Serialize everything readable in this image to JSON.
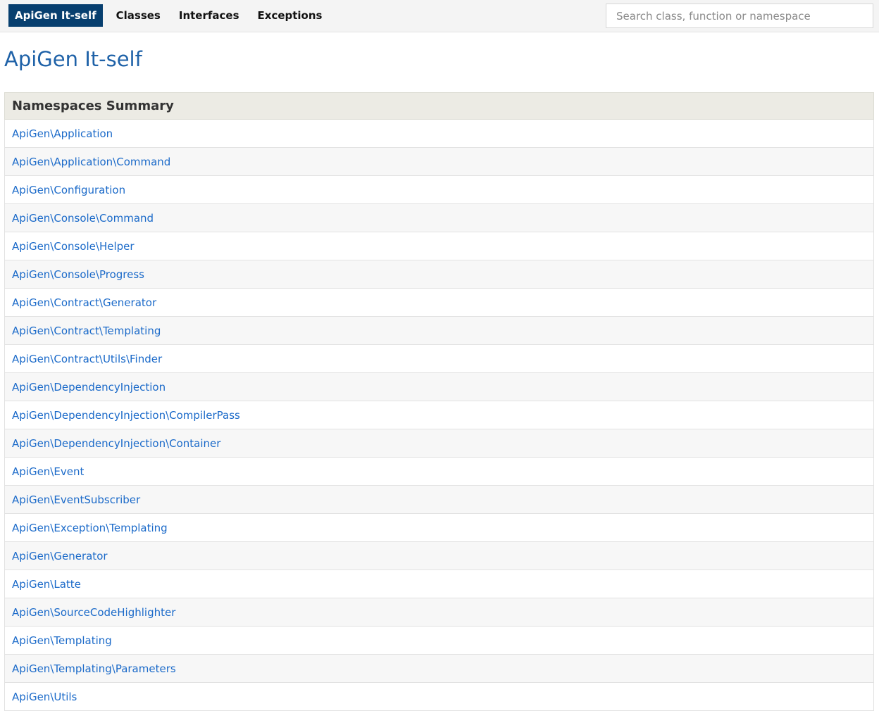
{
  "nav": {
    "brand": "ApiGen It-self",
    "items": [
      "Classes",
      "Interfaces",
      "Exceptions"
    ]
  },
  "search": {
    "placeholder": "Search class, function or namespace",
    "value": ""
  },
  "page_title": "ApiGen It-self",
  "summary": {
    "heading": "Namespaces Summary",
    "rows": [
      "ApiGen\\Application",
      "ApiGen\\Application\\Command",
      "ApiGen\\Configuration",
      "ApiGen\\Console\\Command",
      "ApiGen\\Console\\Helper",
      "ApiGen\\Console\\Progress",
      "ApiGen\\Contract\\Generator",
      "ApiGen\\Contract\\Templating",
      "ApiGen\\Contract\\Utils\\Finder",
      "ApiGen\\DependencyInjection",
      "ApiGen\\DependencyInjection\\CompilerPass",
      "ApiGen\\DependencyInjection\\Container",
      "ApiGen\\Event",
      "ApiGen\\EventSubscriber",
      "ApiGen\\Exception\\Templating",
      "ApiGen\\Generator",
      "ApiGen\\Latte",
      "ApiGen\\SourceCodeHighlighter",
      "ApiGen\\Templating",
      "ApiGen\\Templating\\Parameters",
      "ApiGen\\Utils"
    ]
  },
  "colors": {
    "nav_active_bg": "#073f6f",
    "title": "#1f62a8",
    "link": "#1b6ac9",
    "table_header_bg": "#ecebe4"
  }
}
